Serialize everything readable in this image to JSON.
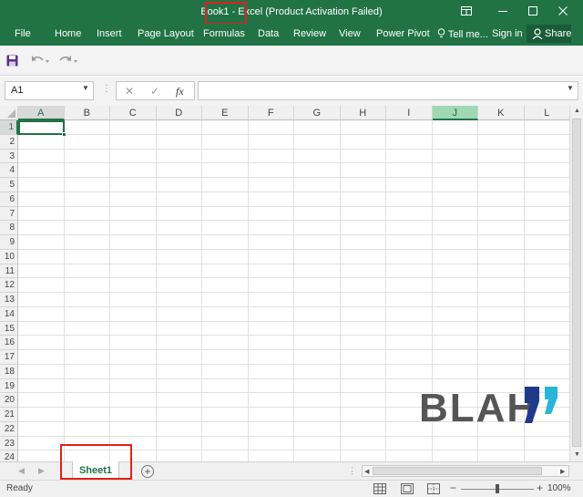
{
  "window": {
    "title": "Book1 - Excel (Product Activation Failed)",
    "accent_color": "#217346",
    "highlight_color": "#e0201b",
    "controls": [
      "ribbon-display-options-icon",
      "minimize-icon",
      "maximize-icon",
      "close-icon"
    ]
  },
  "ribbon": {
    "tabs": [
      {
        "label": "File"
      },
      {
        "label": "Home"
      },
      {
        "label": "Insert"
      },
      {
        "label": "Page Layout"
      },
      {
        "label": "Formulas"
      },
      {
        "label": "Data"
      },
      {
        "label": "Review"
      },
      {
        "label": "View"
      },
      {
        "label": "Power Pivot"
      }
    ],
    "tell_me": "Tell me...",
    "sign_in": "Sign in",
    "share": "Share"
  },
  "quick_access": {
    "icons": [
      "save-icon",
      "undo-icon",
      "redo-icon"
    ]
  },
  "formula_bar": {
    "name_box": "A1",
    "cancel_symbol": "✕",
    "enter_symbol": "✓",
    "function_symbol": "fx",
    "formula_value": ""
  },
  "grid": {
    "columns": [
      "A",
      "B",
      "C",
      "D",
      "E",
      "F",
      "G",
      "H",
      "I",
      "J",
      "K",
      "L"
    ],
    "rows": [
      "1",
      "2",
      "3",
      "4",
      "5",
      "6",
      "7",
      "8",
      "9",
      "10",
      "11",
      "12",
      "13",
      "14",
      "15",
      "16",
      "17",
      "18",
      "19",
      "20",
      "21",
      "22",
      "23",
      "24"
    ],
    "active_cell": "A1",
    "highlighted_column": "J"
  },
  "watermark": {
    "text": "BLAH",
    "quote_colors": [
      "#1f3a8a",
      "#28b5d8"
    ]
  },
  "sheets": {
    "tabs": [
      {
        "label": "Sheet1"
      }
    ],
    "active": "Sheet1",
    "add_symbol": "+"
  },
  "status_bar": {
    "status": "Ready",
    "zoom_minus": "−",
    "zoom_plus": "+",
    "zoom_level": "100%",
    "zoom_value": 100
  }
}
